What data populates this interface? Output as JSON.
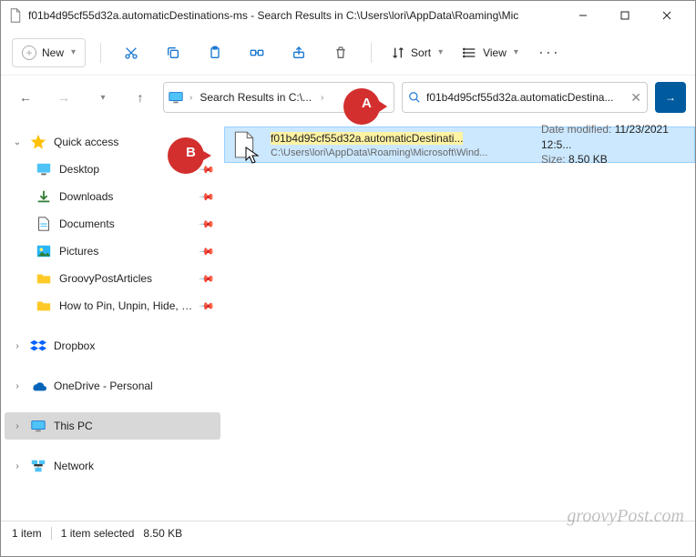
{
  "window": {
    "title": "f01b4d95cf55d32a.automaticDestinations-ms - Search Results in C:\\Users\\lori\\AppData\\Roaming\\Mic"
  },
  "toolbar": {
    "new_label": "New",
    "sort_label": "Sort",
    "view_label": "View"
  },
  "address": {
    "location": "Search Results in C:\\..."
  },
  "search": {
    "query": "f01b4d95cf55d32a.automaticDestina..."
  },
  "sidebar": {
    "quick_access": "Quick access",
    "items": [
      {
        "label": "Desktop",
        "pinned": true,
        "icon": "desktop"
      },
      {
        "label": "Downloads",
        "pinned": true,
        "icon": "download"
      },
      {
        "label": "Documents",
        "pinned": true,
        "icon": "document"
      },
      {
        "label": "Pictures",
        "pinned": true,
        "icon": "picture"
      },
      {
        "label": "GroovyPostArticles",
        "pinned": true,
        "icon": "folder"
      },
      {
        "label": "How to Pin, Unpin, Hide, and",
        "pinned": true,
        "icon": "folder"
      }
    ],
    "dropbox": "Dropbox",
    "onedrive": "OneDrive - Personal",
    "this_pc": "This PC",
    "network": "Network"
  },
  "result": {
    "name": "f01b4d95cf55d32a.automaticDestinati...",
    "path": "C:\\Users\\lori\\AppData\\Roaming\\Microsoft\\Wind...",
    "date_label": "Date modified:",
    "date_value": "11/23/2021 12:5...",
    "size_label": "Size:",
    "size_value": "8.50 KB"
  },
  "status": {
    "count": "1 item",
    "selected": "1 item selected",
    "size": "8.50 KB"
  },
  "callouts": {
    "a": "A",
    "b": "B"
  },
  "watermark": "groovyPost.com"
}
